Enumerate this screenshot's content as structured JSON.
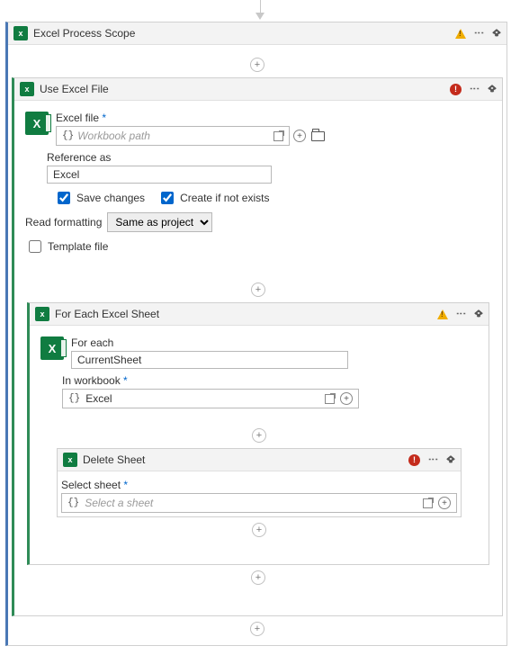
{
  "scope": {
    "title": "Excel Process Scope"
  },
  "useExcel": {
    "title": "Use Excel File",
    "excelFileLabel": "Excel file",
    "workbookPlaceholder": "Workbook path",
    "referenceAsLabel": "Reference as",
    "referenceAsValue": "Excel",
    "saveChangesLabel": "Save changes",
    "saveChangesChecked": true,
    "createIfNotExistsLabel": "Create if not exists",
    "createIfNotExistsChecked": true,
    "readFormattingLabel": "Read formatting",
    "readFormattingValue": "Same as project",
    "templateFileLabel": "Template file",
    "templateFileChecked": false
  },
  "forEach": {
    "title": "For Each Excel Sheet",
    "forEachLabel": "For each",
    "forEachValue": "CurrentSheet",
    "inWorkbookLabel": "In workbook",
    "inWorkbookValue": "Excel"
  },
  "deleteSheet": {
    "title": "Delete Sheet",
    "selectSheetLabel": "Select sheet",
    "selectSheetPlaceholder": "Select a sheet"
  }
}
